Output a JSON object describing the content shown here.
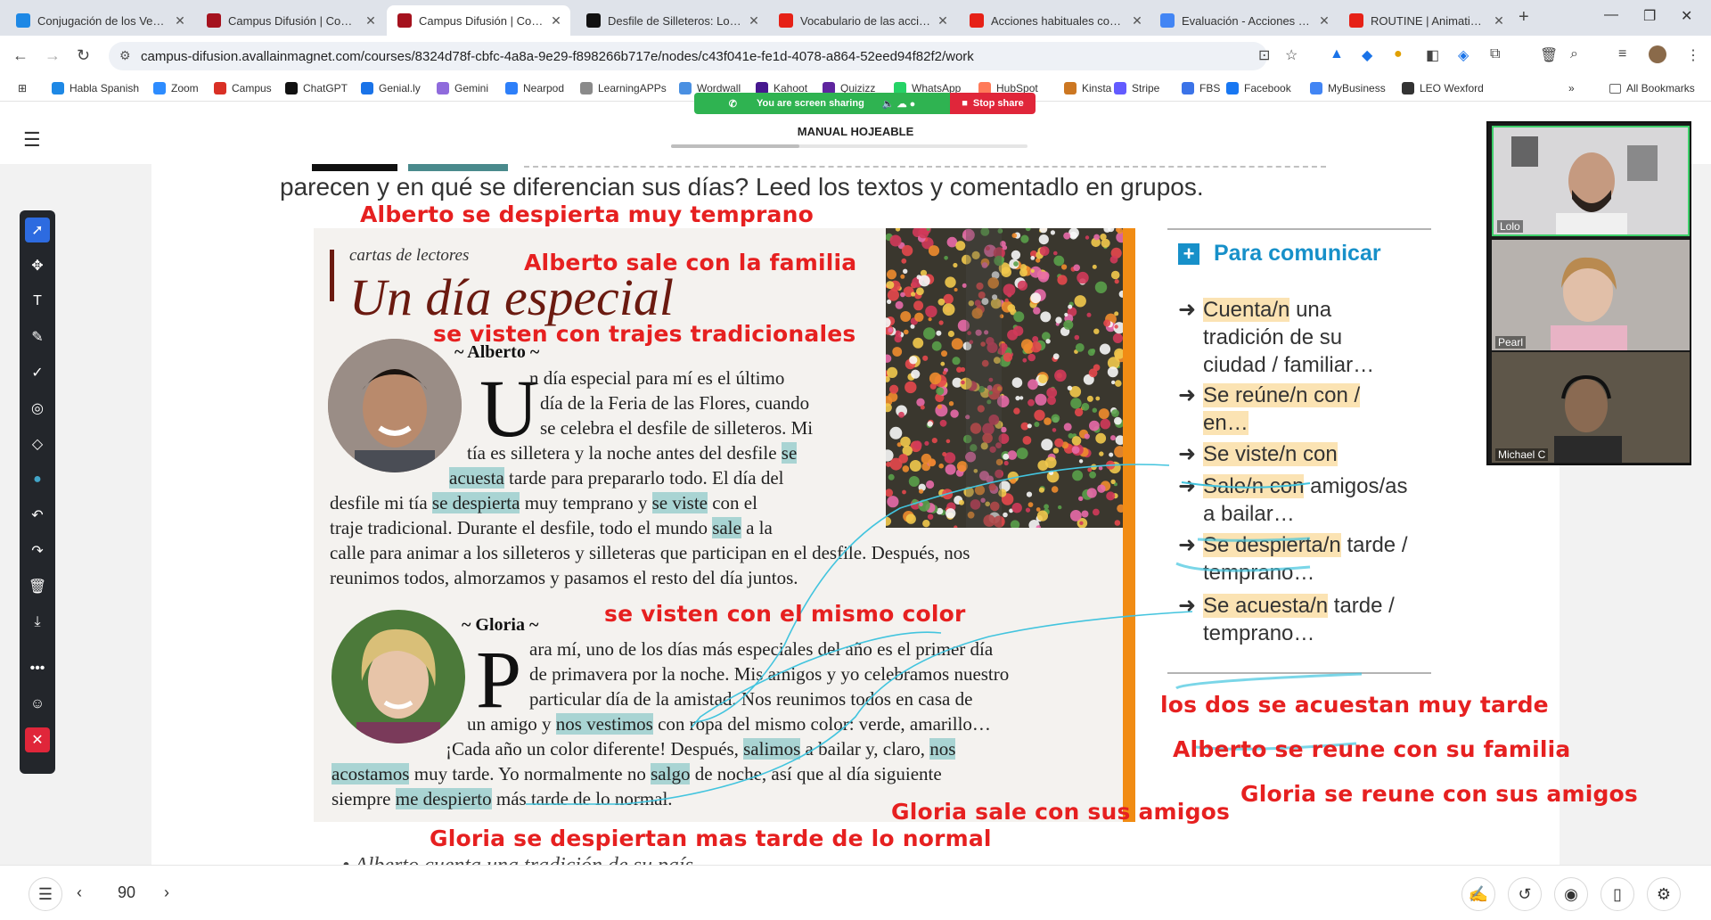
{
  "browser": {
    "tabs": [
      {
        "title": "Conjugación de los Verbos",
        "icon": "puzzle-icon",
        "color": "#1e88e5"
      },
      {
        "title": "Campus Difusión | Courses",
        "icon": "campus-icon",
        "color": "#a5121e"
      },
      {
        "title": "Campus Difusión | Courses",
        "icon": "campus-icon",
        "color": "#a5121e"
      },
      {
        "title": "Desfile de Silleteros: Lo M",
        "icon": "tiktok-icon",
        "color": "#111111"
      },
      {
        "title": "Vocabulario de las acciones",
        "icon": "youtube-icon",
        "color": "#e62117"
      },
      {
        "title": "Acciones habituales con M",
        "icon": "youtube-icon",
        "color": "#e62117"
      },
      {
        "title": "Evaluación - Acciones hab",
        "icon": "google-icon",
        "color": "#4285f4"
      },
      {
        "title": "ROUTINE | Animation shor",
        "icon": "youtube-icon",
        "color": "#e62117"
      }
    ],
    "url": "campus-difusion.avallainmagnet.com/courses/8324d78f-cbfc-4a8a-9e29-f898266b717e/nodes/c43f041e-fe1d-4078-a864-52eed94f82f2/work",
    "bookmarks": [
      "Habla Spanish",
      "Zoom",
      "Campus",
      "ChatGPT",
      "Genial.ly",
      "Gemini",
      "Nearpod",
      "LearningAPPs",
      "Wordwall",
      "Kahoot",
      "Quizizz",
      "WhatsApp",
      "HubSpot",
      "Kinsta",
      "Stripe",
      "FBS",
      "Facebook",
      "MyBusiness",
      "LEO Wexford"
    ],
    "all_bookmarks": "All Bookmarks"
  },
  "share_banner": {
    "status": "You are screen sharing",
    "stop": "Stop share"
  },
  "app": {
    "title": "MANUAL HOJEABLE",
    "progress": 0.36
  },
  "book": {
    "intro": "parecen y en qué se diferencian sus días? Leed los textos y comentadlo en grupos.",
    "kicker": "cartas de lectores",
    "title": "Un día especial",
    "alberto": {
      "name": "~ Alberto ~",
      "dropcap": "U",
      "lines": [
        {
          "parts": [
            {
              "t": "n día especial para mí es el último"
            }
          ]
        },
        {
          "parts": [
            {
              "t": "día de la Feria de las Flores, cuando"
            }
          ]
        },
        {
          "parts": [
            {
              "t": "se celebra el desfile de silleteros. Mi"
            }
          ]
        },
        {
          "parts": [
            {
              "t": "tía es silletera y la noche antes del desfile "
            },
            {
              "t": "se",
              "h": true
            }
          ]
        },
        {
          "parts": [
            {
              "t": "acuesta",
              "h": true
            },
            {
              "t": " tarde para prepararlo todo. El día del"
            }
          ]
        },
        {
          "parts": [
            {
              "t": "desfile mi tía "
            },
            {
              "t": "se despierta",
              "h": true
            },
            {
              "t": " muy temprano y "
            },
            {
              "t": "se viste",
              "h": true
            },
            {
              "t": " con el"
            }
          ]
        },
        {
          "parts": [
            {
              "t": "traje tradicional. Durante el desfile, todo el mundo "
            },
            {
              "t": "sale",
              "h": true
            },
            {
              "t": " a la"
            }
          ]
        },
        {
          "parts": [
            {
              "t": "calle para animar a los silleteros y silleteras que participan en el desfile. Después, nos"
            }
          ]
        },
        {
          "parts": [
            {
              "t": "reunimos todos, almorzamos y pasamos el resto del día juntos."
            }
          ]
        }
      ]
    },
    "gloria": {
      "name": "~ Gloria ~",
      "dropcap": "P",
      "lines": [
        {
          "parts": [
            {
              "t": "ara mí, uno de los días más especiales del año es el primer día"
            }
          ]
        },
        {
          "parts": [
            {
              "t": "de primavera por la noche. Mis amigos y yo celebramos nuestro"
            }
          ]
        },
        {
          "parts": [
            {
              "t": "particular día de la amistad. Nos reunimos todos en casa de"
            }
          ]
        },
        {
          "parts": [
            {
              "t": "un amigo y "
            },
            {
              "t": "nos vestimos",
              "h": true
            },
            {
              "t": " con ropa del mismo color: verde, amarillo…"
            }
          ]
        },
        {
          "parts": [
            {
              "t": "¡Cada año un color diferente! Después, "
            },
            {
              "t": "salimos",
              "h": true
            },
            {
              "t": " a bailar y, claro, "
            },
            {
              "t": "nos",
              "h": true
            }
          ]
        },
        {
          "parts": [
            {
              "t": "acostamos",
              "h": true
            },
            {
              "t": " muy tarde. Yo normalmente no "
            },
            {
              "t": "salgo",
              "h": true
            },
            {
              "t": " de noche, así que al día siguiente"
            }
          ]
        },
        {
          "parts": [
            {
              "t": "siempre "
            },
            {
              "t": "me despierto",
              "h": true
            },
            {
              "t": " más tarde de lo normal."
            }
          ]
        }
      ]
    },
    "bottom_cut": "• Alberto cuenta una tradición de su país."
  },
  "para_comunicar": {
    "title": "Para comunicar",
    "items": [
      {
        "hl": "Cuenta/n",
        "rest": " una",
        "cont": [
          "tradición de su",
          "ciudad / familiar…"
        ]
      },
      {
        "hl": "Se reúne/n con /",
        "rest": "",
        "cont": [
          "en…"
        ],
        "cont_hl": true
      },
      {
        "hl": "Se viste/n con",
        "rest": "",
        "cont": []
      },
      {
        "hl": "Sale/n con",
        "rest": " amigos/as",
        "cont": [
          "a bailar…"
        ],
        "cont_hl_first": "a"
      },
      {
        "hl": "Se despierta/n",
        "rest": " tarde /",
        "cont": [
          "temprano…"
        ]
      },
      {
        "hl": "Se acuesta/n",
        "rest": " tarde /",
        "cont": [
          "temprano…"
        ]
      }
    ]
  },
  "annotations": [
    "Alberto se despierta muy temprano",
    "Alberto sale con la familia",
    "se visten con trajes tradicionales",
    "se visten con el mismo color",
    "los dos se acuestan muy tarde",
    "Alberto se reune con su familia",
    "Gloria se reune con sus amigos",
    "Gloria sale con sus amigos",
    "Gloria se despiertan mas tarde de lo normal"
  ],
  "video": [
    {
      "name": "Lolo"
    },
    {
      "name": "Pearl"
    },
    {
      "name": "Michael C"
    }
  ],
  "footer": {
    "page": "90"
  },
  "colors": {
    "annotation": "#e62020",
    "highlight": "#a9d4d3",
    "accent": "#1790c9",
    "orange": "#f18c14",
    "title": "#6b1a10"
  }
}
